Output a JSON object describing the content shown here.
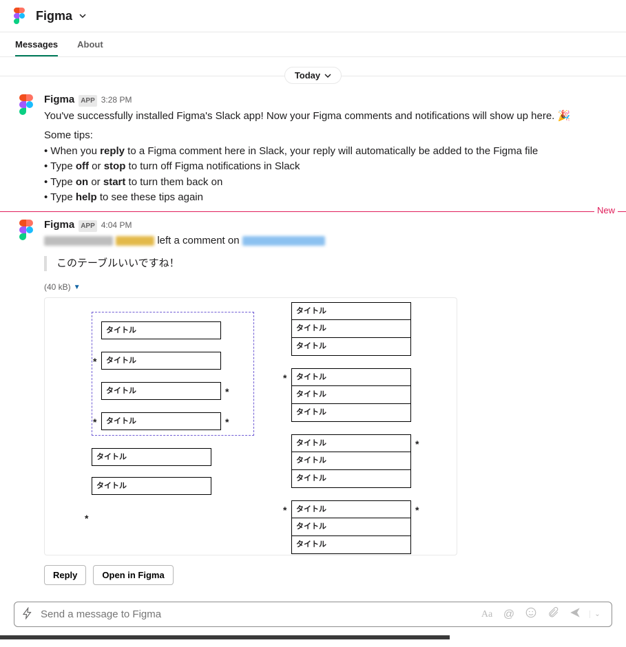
{
  "header": {
    "title": "Figma"
  },
  "tabs": {
    "messages": "Messages",
    "about": "About"
  },
  "dateDivider": "Today",
  "newLabel": "New",
  "messages": [
    {
      "sender": "Figma",
      "badge": "APP",
      "time": "3:28 PM",
      "intro": "You've successfully installed Figma's Slack app! Now your Figma comments and notifications will show up here. 🎉",
      "tipsHeading": "Some tips:",
      "tips": {
        "t1a": "When you ",
        "t1b": "reply",
        "t1c": " to a Figma comment here in Slack, your reply will automatically be added to the Figma file",
        "t2a": "Type ",
        "t2b": "off",
        "t2c": " or ",
        "t2d": "stop",
        "t2e": " to turn off Figma notifications in Slack",
        "t3a": "Type ",
        "t3b": "on",
        "t3c": " or ",
        "t3d": "start",
        "t3e": " to turn them back on",
        "t4a": "Type ",
        "t4b": "help",
        "t4c": " to see these tips again"
      }
    },
    {
      "sender": "Figma",
      "badge": "APP",
      "time": "4:04 PM",
      "commentMid": " left a comment on ",
      "quote": "このテーブルいいですね！",
      "attachmentSize": "(40 kB)",
      "previewLabel": "タイトル",
      "actions": {
        "reply": "Reply",
        "open": "Open in Figma"
      }
    }
  ],
  "composer": {
    "placeholder": "Send a message to Figma"
  }
}
